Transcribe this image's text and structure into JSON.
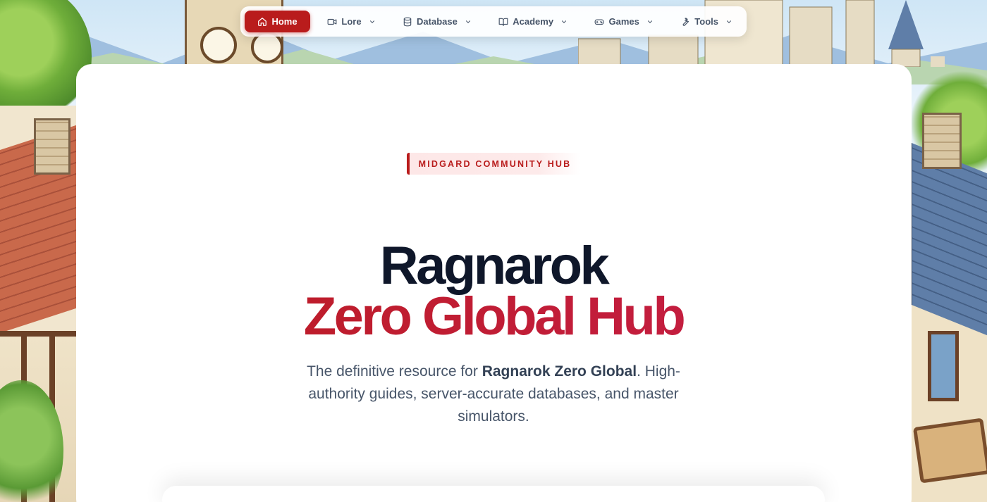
{
  "nav": {
    "items": [
      {
        "label": "Home",
        "icon": "home-icon",
        "active": true,
        "dropdown": false
      },
      {
        "label": "Lore",
        "icon": "video-icon",
        "active": false,
        "dropdown": true
      },
      {
        "label": "Database",
        "icon": "database-icon",
        "active": false,
        "dropdown": true
      },
      {
        "label": "Academy",
        "icon": "book-open-icon",
        "active": false,
        "dropdown": true
      },
      {
        "label": "Games",
        "icon": "gamepad-icon",
        "active": false,
        "dropdown": true
      },
      {
        "label": "Tools",
        "icon": "wrench-icon",
        "active": false,
        "dropdown": true
      }
    ]
  },
  "hero": {
    "badge": "MIDGARD COMMUNITY HUB",
    "title_line1": "Ragnarok",
    "title_line2": "Zero Global Hub",
    "subtitle_prefix": "The definitive resource for ",
    "subtitle_bold": "Ragnarok Zero Global",
    "subtitle_suffix": ". High-authority guides, server-accurate databases, and master simulators."
  },
  "colors": {
    "accent": "#b91c1c",
    "title_dark": "#0f172a",
    "text_muted": "#475569"
  }
}
